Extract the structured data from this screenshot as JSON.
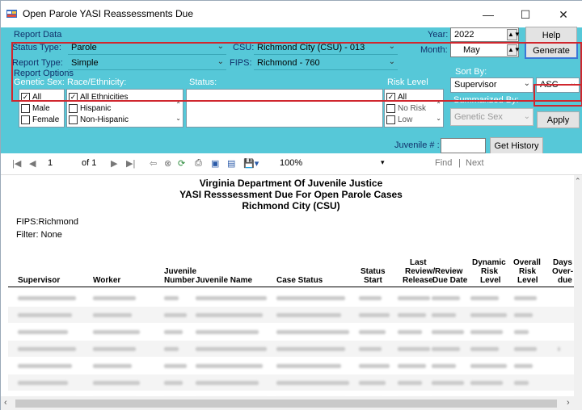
{
  "window": {
    "title": "Open Parole YASI Reassessments Due",
    "minimize": "—",
    "maximize": "☐",
    "close": "✕"
  },
  "report_data": {
    "group_label": "Report Data",
    "status_type_label": "Status Type:",
    "status_type_value": "Parole",
    "report_type_label": "Report Type:",
    "report_type_value": "Simple",
    "csu_label": "CSU:",
    "csu_value": "Richmond City (CSU) - 013",
    "fips_label": "FIPS:",
    "fips_value": "Richmond - 760",
    "year_label": "Year:",
    "year_value": "2022",
    "month_label": "Month:",
    "month_value": "May",
    "help_button": "Help",
    "generate_button": "Generate"
  },
  "report_options": {
    "group_label": "Report Options",
    "genetic_sex_label": "Genetic Sex:",
    "genetic_sex_items": [
      {
        "label": "All",
        "checked": true
      },
      {
        "label": "Male",
        "checked": false
      },
      {
        "label": "Female",
        "checked": false
      }
    ],
    "race_label": "Race/Ethnicity:",
    "race_items": [
      {
        "label": "All Ethnicities",
        "checked": true
      },
      {
        "label": "Hispanic",
        "checked": false
      },
      {
        "label": "Non-Hispanic",
        "checked": false
      }
    ],
    "status_label": "Status:",
    "risk_label": "Risk Level",
    "risk_items": [
      {
        "label": "All",
        "checked": true
      },
      {
        "label": "No Risk",
        "checked": false
      },
      {
        "label": "Low",
        "checked": false
      }
    ],
    "sort_by_label": "Sort By:",
    "sort_by_value": "Supervisor",
    "sort_order_value": "ASC",
    "summarized_by_label": "Summarized By:",
    "summarized_by_value": "Genetic Sex",
    "apply_button": "Apply"
  },
  "juvenile_search": {
    "label": "Juvenile # :",
    "value": "",
    "button": "Get History"
  },
  "toolbar": {
    "page_value": "1",
    "page_of": "of 1",
    "zoom": "100%",
    "find": "Find",
    "separator": "|",
    "next": "Next"
  },
  "report": {
    "org": "Virginia Department Of Juvenile Justice",
    "title": "YASI Resssessment Due For Open Parole Cases",
    "subtitle": "Richmond City (CSU)",
    "fips": "FIPS:Richmond",
    "filter": "Filter: None",
    "columns": {
      "supervisor": "Supervisor",
      "worker": "Worker",
      "juvenile_number_1": "Juvenile",
      "juvenile_number_2": "Number",
      "juvenile_name": "Juvenile Name",
      "case_status": "Case Status",
      "status_start_1": "Status",
      "status_start_2": "Start",
      "last_review_1": "Last",
      "last_review_2": "Review/",
      "last_review_3": "Release",
      "review_due_1": "Review",
      "review_due_2": "Due Date",
      "dynamic_risk_1": "Dynamic",
      "dynamic_risk_2": "Risk",
      "dynamic_risk_3": "Level",
      "overall_risk_1": "Overall",
      "overall_risk_2": "Risk",
      "overall_risk_3": "Level",
      "days_overdue_1": "Days",
      "days_overdue_2": "Over-",
      "days_overdue_3": "due"
    }
  },
  "colors": {
    "panel": "#56c8d8",
    "label_text": "#10306a",
    "highlight_border": "#d0272e",
    "redacted": "#c9c9c9"
  },
  "icons": [
    "first-page-icon",
    "prev-page-icon",
    "next-page-icon",
    "last-page-icon",
    "back-icon",
    "stop-icon",
    "refresh-icon",
    "print-icon",
    "print-layout-icon",
    "page-setup-icon",
    "export-icon"
  ]
}
